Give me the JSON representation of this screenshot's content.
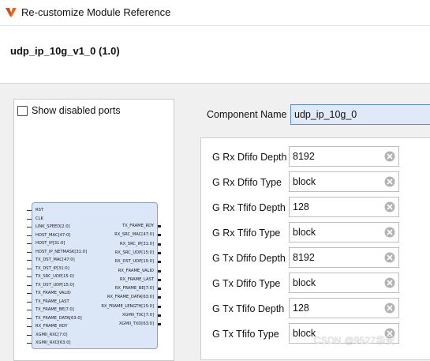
{
  "window": {
    "title": "Re-customize Module Reference",
    "icon": "vivado-logo-icon"
  },
  "header": {
    "ip_name": "udp_ip_10g_v1_0 (1.0)"
  },
  "symbol": {
    "show_disabled_label": "Show disabled ports",
    "show_disabled_checked": false,
    "inputs": [
      "RST",
      "CLK",
      "LINK_SPEED[2:0]",
      "HOST_MAC[47:0]",
      "HOST_IP[31:0]",
      "HOST_IP_NETMASK[31:0]",
      "TX_DST_MAC[47:0]",
      "TX_DST_IP[31:0]",
      "TX_SRC_UDP[15:0]",
      "TX_DST_UDP[15:0]",
      "TX_FRAME_VALID",
      "TX_FRAME_LAST",
      "TX_FRAME_BE[7:0]",
      "TX_FRAME_DATA[63:0]",
      "RX_FRAME_RDY",
      "XGMII_RXC[7:0]",
      "XGMII_RXD[63:0]"
    ],
    "outputs": [
      "TX_FRAME_RDY",
      "RX_SRC_MAC[47:0]",
      "RX_SRC_IP[31:0]",
      "RX_SRC_UDP[15:0]",
      "RX_DST_UDP[15:0]",
      "RX_FRAME_VALID",
      "RX_FRAME_LAST",
      "RX_FRAME_BE[7:0]",
      "RX_FRAME_DATA[63:0]",
      "RX_FRAME_LENGTH[15:0]",
      "XGMII_TXC[7:0]",
      "XGMII_TXD[63:0]"
    ]
  },
  "component": {
    "label": "Component Name",
    "value": "udp_ip_10g_0"
  },
  "params": [
    {
      "label": "G Rx Dfifo Depth",
      "value": "8192"
    },
    {
      "label": "G Rx Dfifo Type",
      "value": "block"
    },
    {
      "label": "G Rx Tfifo Depth",
      "value": "128"
    },
    {
      "label": "G Rx Tfifo Type",
      "value": "block"
    },
    {
      "label": "G Tx Dfifo Depth",
      "value": "8192"
    },
    {
      "label": "G Tx Dfifo Type",
      "value": "block"
    },
    {
      "label": "G Tx Tfifo Depth",
      "value": "128"
    },
    {
      "label": "G Tx Tfifo Type",
      "value": "block"
    }
  ],
  "watermark": "CSDN @9527华安",
  "colors": {
    "block_fill": "#dbe7f7",
    "block_border": "#8aa2c6",
    "focus_border": "#5a8ccc"
  }
}
